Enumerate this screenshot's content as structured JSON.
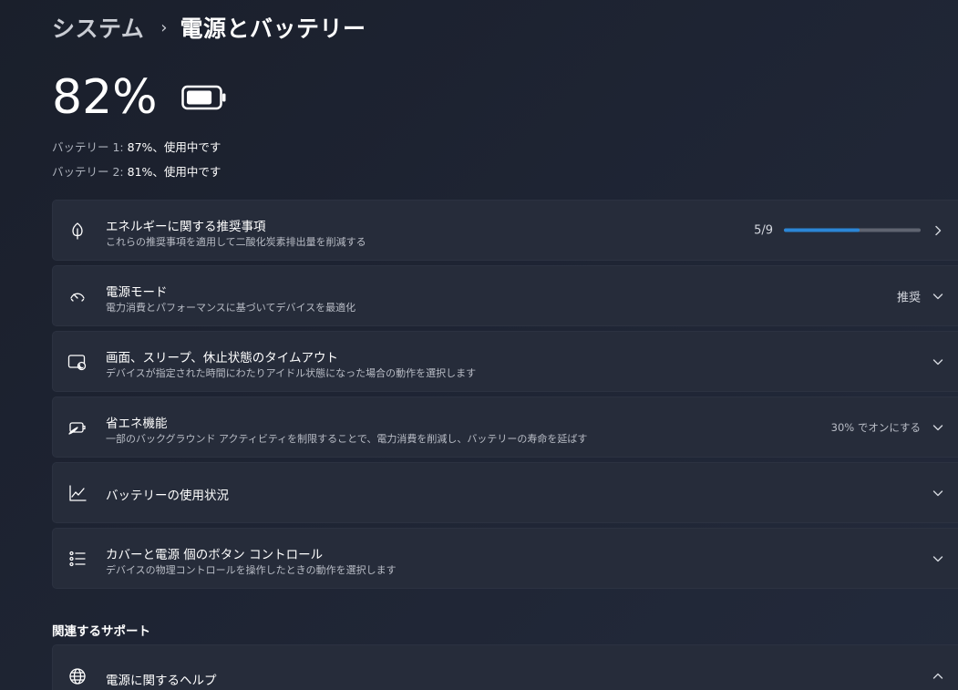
{
  "breadcrumb": {
    "parent": "システム",
    "separator": "›",
    "current": "電源とバッテリー"
  },
  "battery": {
    "percent": "82%",
    "level": 0.82,
    "lines": [
      {
        "label": "バッテリー 1: ",
        "value": "87%、使用中です"
      },
      {
        "label": "バッテリー 2: ",
        "value": "81%、使用中です"
      }
    ]
  },
  "cards": {
    "energy": {
      "title": "エネルギーに関する推奨事項",
      "subtitle": "これらの推奨事項を適用して二酸化炭素排出量を削減する",
      "progress_label": "5/9",
      "progress_fraction": 0.556,
      "icon": "leaf-icon"
    },
    "power_mode": {
      "title": "電源モード",
      "subtitle": "電力消費とパフォーマンスに基づいてデバイスを最適化",
      "value": "推奨",
      "icon": "speedometer-icon"
    },
    "screen_sleep": {
      "title": "画面、スリープ、休止状態のタイムアウト",
      "subtitle": "デバイスが指定された時間にわたりアイドル状態になった場合の動作を選択します",
      "icon": "screen-sleep-icon"
    },
    "battery_saver": {
      "title": "省エネ機能",
      "subtitle": "一部のバックグラウンド アクティビティを制限することで、電力消費を削減し、バッテリーの寿命を延ばす",
      "value": "30% でオンにする",
      "icon": "battery-saver-icon"
    },
    "battery_usage": {
      "title": "バッテリーの使用状況",
      "icon": "line-chart-icon"
    },
    "lid_power": {
      "title": "カバーと電源 個のボタン コントロール",
      "subtitle": "デバイスの物理コントロールを操作したときの動作を選択します",
      "icon": "list-settings-icon"
    }
  },
  "related": {
    "heading": "関連するサポート",
    "help_title": "電源に関するヘルプ",
    "icon": "globe-icon"
  },
  "colors": {
    "accent": "#2b86d6",
    "card_bg": "#262c3a",
    "page_bg": "#1e2433"
  }
}
